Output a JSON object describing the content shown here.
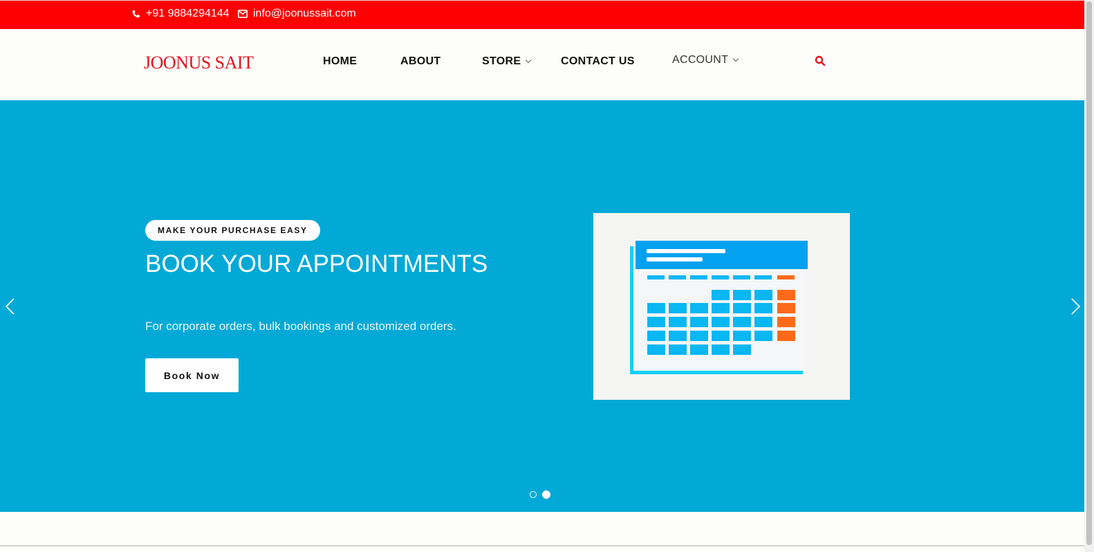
{
  "topbar": {
    "phone": "+91 9884294144",
    "email": "info@joonussait.com",
    "phone_icon": "phone-icon",
    "email_icon": "envelope-icon",
    "background": "#ff0000"
  },
  "brand": {
    "logo_text": "JOONUS SAIT",
    "color": "#e0161c"
  },
  "nav": {
    "home": "HOME",
    "about": "ABOUT",
    "store": "STORE",
    "contact": "CONTACT US",
    "account": "ACCOUNT",
    "search_icon": "search-icon",
    "search_color": "#e0161c"
  },
  "hero": {
    "background": "#02a9d7",
    "badge": "MAKE YOUR PURCHASE EASY",
    "headline": "BOOK YOUR APPOINTMENTS",
    "subtext": "For corporate orders, bulk bookings and customized orders.",
    "button": "Book Now",
    "image": "calendar-illustration",
    "slides_total": 2,
    "active_slide": 2
  }
}
